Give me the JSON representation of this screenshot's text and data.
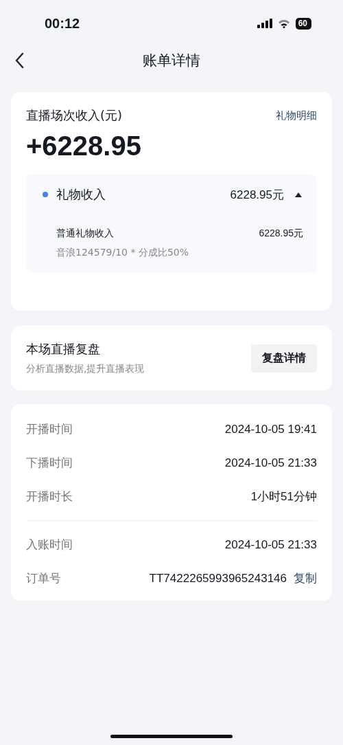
{
  "status_bar": {
    "time": "00:12",
    "battery": "60"
  },
  "nav": {
    "title": "账单详情"
  },
  "income": {
    "title": "直播场次收入(元)",
    "link": "礼物明细",
    "amount": "+6228.95",
    "breakdown": {
      "label": "礼物收入",
      "value": "6228.95元",
      "expanded": true,
      "items": [
        {
          "label": "普通礼物收入",
          "value": "6228.95元",
          "note": "音浪124579/10 * 分成比50%"
        }
      ]
    }
  },
  "review": {
    "title": "本场直播复盘",
    "subtitle": "分析直播数据,提升直播表现",
    "button": "复盘详情"
  },
  "info_groups": [
    [
      {
        "label": "开播时间",
        "value": "2024-10-05 19:41"
      },
      {
        "label": "下播时间",
        "value": "2024-10-05 21:33"
      },
      {
        "label": "开播时长",
        "value": "1小时51分钟"
      }
    ],
    [
      {
        "label": "入账时间",
        "value": "2024-10-05 21:33"
      },
      {
        "label": "订单号",
        "value": "TT7422265993965243146",
        "action": "复制"
      }
    ]
  ]
}
